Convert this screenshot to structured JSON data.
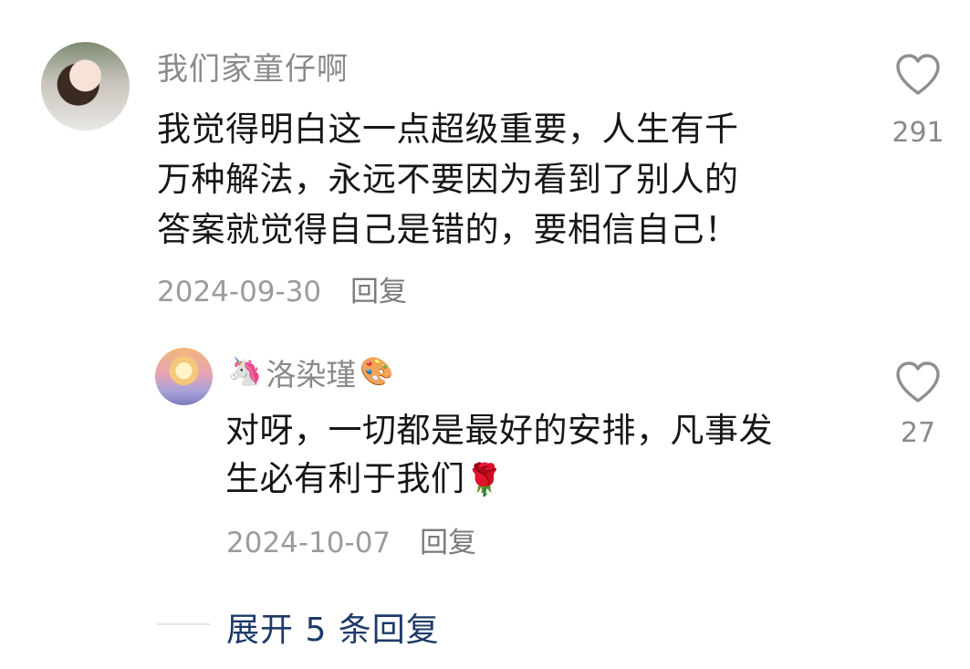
{
  "comment": {
    "username": "我们家童仔啊",
    "text_lines": [
      "我觉得明白这一点超级重要，人生有千",
      "万种解法，永远不要因为看到了别人的",
      "答案就觉得自己是错的，要相信自己！"
    ],
    "date": "2024-09-30",
    "reply_label": "回复",
    "like_count": "291",
    "avatar_icon": "user-avatar-photo"
  },
  "reply": {
    "username": "洛染瑾",
    "username_prefix_emoji": "🦄",
    "username_suffix_emoji": "🎨",
    "text_lines": [
      "对呀，一切都是最好的安排，凡事发",
      "生必有利于我们"
    ],
    "text_suffix_emoji": "🌹",
    "date": "2024-10-07",
    "reply_label": "回复",
    "like_count": "27",
    "avatar_icon": "user-avatar-sunset"
  },
  "expand": {
    "label": "展开 5 条回复"
  },
  "icons": {
    "like": "heart-outline-icon"
  },
  "colors": {
    "expand_link": "#1e3a68",
    "meta_text": "#9b9b9b",
    "username_text": "#8a8a8a"
  }
}
